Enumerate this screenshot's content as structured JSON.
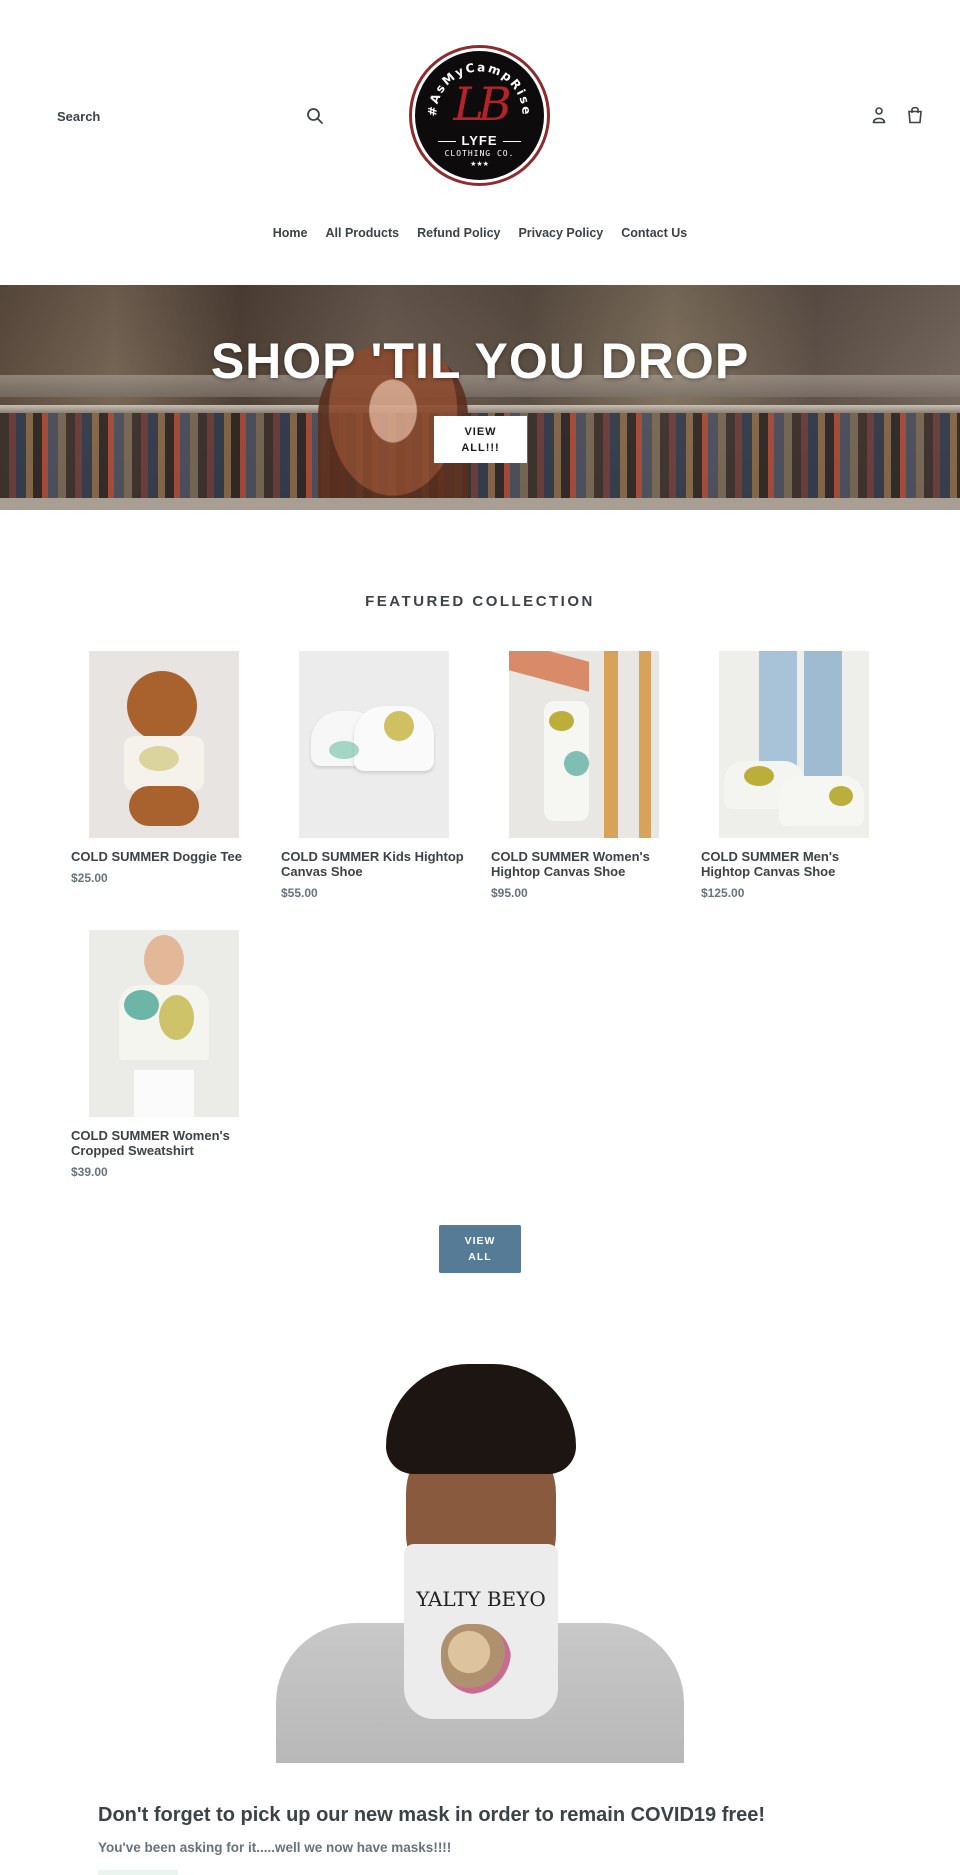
{
  "header": {
    "search_placeholder": "Search",
    "search_icon": "search-icon",
    "logo": {
      "arc_text": "#AsMyCampRise",
      "monogram": "LB",
      "name": "LYFE",
      "subtitle": "CLOTHING CO.",
      "stars": "★★★"
    },
    "account_icon": "account-icon",
    "cart_icon": "cart-icon"
  },
  "nav": {
    "items": [
      {
        "label": "Home"
      },
      {
        "label": "All Products"
      },
      {
        "label": "Refund Policy"
      },
      {
        "label": "Privacy Policy"
      },
      {
        "label": "Contact Us"
      }
    ]
  },
  "hero": {
    "title": "SHOP 'TIL YOU DROP",
    "button_line1": "VIEW",
    "button_line2": "ALL!!!"
  },
  "featured": {
    "title": "FEATURED COLLECTION",
    "products": [
      {
        "name": "COLD SUMMER Doggie Tee",
        "price": "$25.00"
      },
      {
        "name": "COLD SUMMER Kids Hightop Canvas Shoe",
        "price": "$55.00"
      },
      {
        "name": "COLD SUMMER Women's Hightop Canvas Shoe",
        "price": "$95.00"
      },
      {
        "name": "COLD SUMMER Men's Hightop Canvas Shoe",
        "price": "$125.00"
      },
      {
        "name": "COLD SUMMER Women's Cropped Sweatshirt",
        "price": "$39.00"
      }
    ],
    "view_all_line1": "VIEW",
    "view_all_line2": "ALL"
  },
  "mask_feature": {
    "image_text": "YALTY BEYO",
    "heading": "Don't forget to pick up our new mask in order to remain COVID19 free!",
    "subtext": "You've been asking for it.....well we now have masks!!!!"
  },
  "colors": {
    "accent_button": "#557b97",
    "text_primary": "#3d4246",
    "text_secondary": "#69727b",
    "logo_red": "#b3232a"
  }
}
